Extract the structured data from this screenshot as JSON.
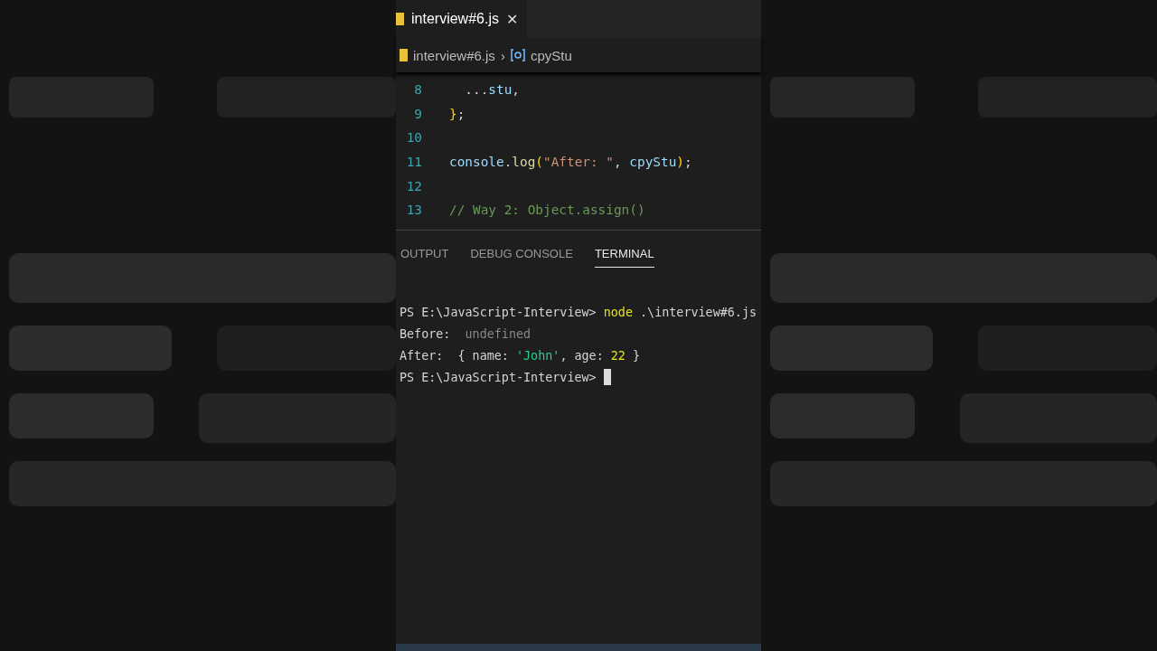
{
  "editor_tab": {
    "label": "interview#6.js",
    "selected": true,
    "close": "✕"
  },
  "breadcrumb": {
    "file": "interview#6.js",
    "separator": "›",
    "symbol": "cpyStu"
  },
  "code_lines": [
    {
      "number": "8",
      "tokens": [
        {
          "text": "  ...",
          "kind": "plain"
        },
        {
          "text": "stu",
          "kind": "variable"
        },
        {
          "text": ",",
          "kind": "plain"
        }
      ]
    },
    {
      "number": "9",
      "tokens": [
        {
          "text": "}",
          "kind": "brace"
        },
        {
          "text": ";",
          "kind": "plain"
        }
      ]
    },
    {
      "number": "10"
    },
    {
      "number": "11",
      "tokens": [
        {
          "text": "console",
          "kind": "variable"
        },
        {
          "text": ".",
          "kind": "plain"
        },
        {
          "text": "log",
          "kind": "function"
        },
        {
          "text": "(",
          "kind": "brace"
        },
        {
          "text": "\"After: \"",
          "kind": "string"
        },
        {
          "text": ", ",
          "kind": "plain"
        },
        {
          "text": "cpyStu",
          "kind": "variable"
        },
        {
          "text": ")",
          "kind": "brace"
        },
        {
          "text": ";",
          "kind": "plain"
        }
      ]
    },
    {
      "number": "12"
    },
    {
      "number": "13",
      "tokens": [
        {
          "text": "// Way 2: Object.assign()",
          "kind": "comment"
        }
      ]
    }
  ],
  "panel_tabs": [
    {
      "label": "OUTPUT",
      "selected": false
    },
    {
      "label": "DEBUG CONSOLE",
      "selected": false
    },
    {
      "label": "TERMINAL",
      "selected": true
    }
  ],
  "terminal_lines": [
    {
      "tokens": [
        {
          "text": "PS E:\\JavaScript-Interview> ",
          "kind": "plain"
        },
        {
          "text": "node",
          "kind": "command"
        },
        {
          "text": " .\\interview#6.js",
          "kind": "plain"
        }
      ]
    },
    {
      "tokens": [
        {
          "text": "Before: ",
          "kind": "plain"
        },
        {
          "text": " undefined",
          "kind": "muted"
        }
      ]
    },
    {
      "tokens": [
        {
          "text": "After:  { name: ",
          "kind": "plain"
        },
        {
          "text": "'John'",
          "kind": "string"
        },
        {
          "text": ", age: ",
          "kind": "plain"
        },
        {
          "text": "22",
          "kind": "number"
        },
        {
          "text": " }",
          "kind": "plain"
        }
      ]
    },
    {
      "tokens": [
        {
          "text": "PS E:\\JavaScript-Interview> ",
          "kind": "plain"
        }
      ],
      "cursor": true
    }
  ]
}
